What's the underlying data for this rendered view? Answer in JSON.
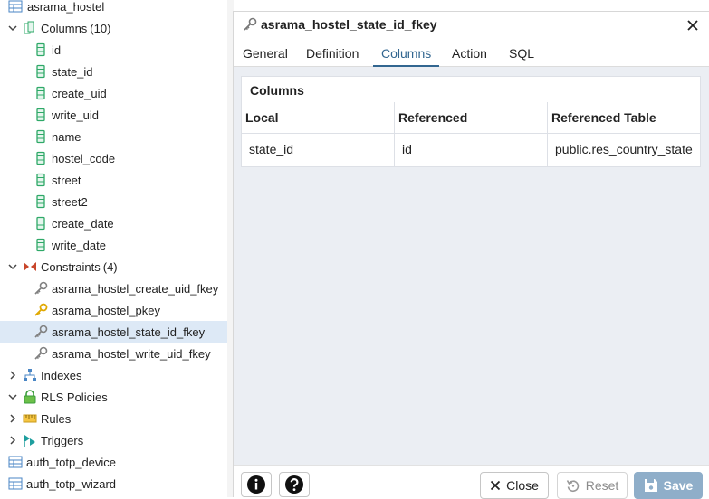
{
  "tree": {
    "table_name": "asrama_hostel",
    "columns_node": {
      "label": "Columns",
      "count": "(10)"
    },
    "columns": [
      "id",
      "state_id",
      "create_uid",
      "write_uid",
      "name",
      "hostel_code",
      "street",
      "street2",
      "create_date",
      "write_date"
    ],
    "constraints_node": {
      "label": "Constraints",
      "count": "(4)"
    },
    "constraints": [
      {
        "label": "asrama_hostel_create_uid_fkey",
        "icon": "foreign-key-icon",
        "selected": false
      },
      {
        "label": "asrama_hostel_pkey",
        "icon": "primary-key-icon",
        "selected": false
      },
      {
        "label": "asrama_hostel_state_id_fkey",
        "icon": "foreign-key-icon",
        "selected": true
      },
      {
        "label": "asrama_hostel_write_uid_fkey",
        "icon": "foreign-key-icon",
        "selected": false
      }
    ],
    "indexes": "Indexes",
    "rls_policies": "RLS Policies",
    "rules": "Rules",
    "triggers": "Triggers",
    "tables_after": [
      "auth_totp_device",
      "auth_totp_wizard"
    ]
  },
  "dialog": {
    "title": "asrama_hostel_state_id_fkey",
    "tabs": [
      {
        "label": "General",
        "active": false
      },
      {
        "label": "Definition",
        "active": false
      },
      {
        "label": "Columns",
        "active": true
      },
      {
        "label": "Action",
        "active": false
      },
      {
        "label": "SQL",
        "active": false
      }
    ],
    "columns_panel": {
      "title": "Columns",
      "headers": [
        "Local",
        "Referenced",
        "Referenced Table"
      ],
      "rows": [
        [
          "state_id",
          "id",
          "public.res_country_state"
        ]
      ]
    },
    "footer": {
      "info_icon": "info-icon",
      "help_icon": "help-icon",
      "close_label": "Close",
      "reset_label": "Reset",
      "save_label": "Save"
    }
  },
  "colors": {
    "accent": "#326690",
    "selected_row": "#dde9f6",
    "column_icon": "#2fa968",
    "save_button": "#8faec9"
  }
}
